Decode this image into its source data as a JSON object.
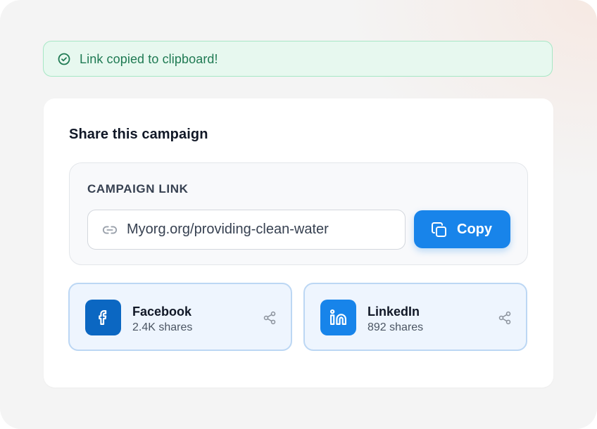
{
  "toast": {
    "message": "Link copied to clipboard!",
    "icon": "check-circle-icon",
    "color": "#1f7a53"
  },
  "share": {
    "title": "Share this campaign",
    "link_label": "CAMPAIGN LINK",
    "link_value": "Myorg.org/providing-clean-water",
    "link_icon": "link-icon",
    "copy_label": "Copy",
    "copy_icon": "copy-icon",
    "accent_color": "#1884ea"
  },
  "socials": [
    {
      "name": "Facebook",
      "shares": "2.4K shares",
      "icon": "facebook-icon",
      "color": "#0b67c2"
    },
    {
      "name": "LinkedIn",
      "shares": "892 shares",
      "icon": "linkedin-icon",
      "color": "#1784ea"
    }
  ]
}
